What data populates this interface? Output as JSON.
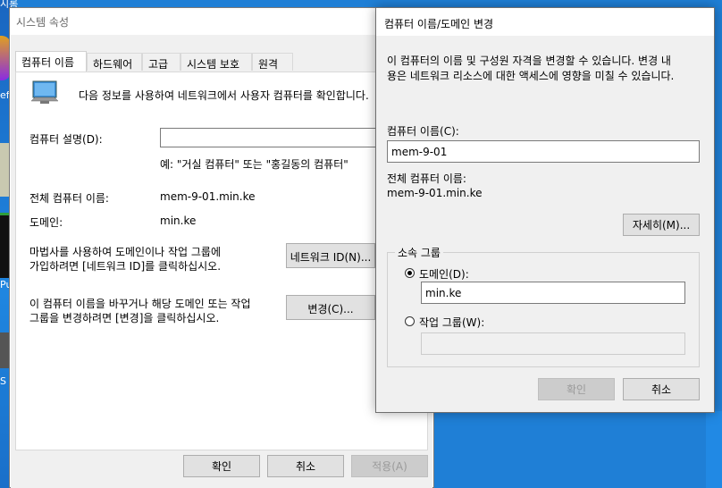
{
  "desktop": {
    "top_label": "시롬",
    "side_labels": [
      "ef",
      "Pu",
      "S"
    ]
  },
  "system_properties": {
    "title": "시스템 속성",
    "tabs": [
      {
        "label": "컴퓨터 이름",
        "active": true
      },
      {
        "label": "하드웨어",
        "active": false
      },
      {
        "label": "고급",
        "active": false
      },
      {
        "label": "시스템 보호",
        "active": false
      },
      {
        "label": "원격",
        "active": false
      }
    ],
    "intro_text": "다음 정보를 사용하여 네트워크에서 사용자 컴퓨터를 확인합니다.",
    "description_label": "컴퓨터 설명(D):",
    "description_value": "",
    "description_example": "예: \"거실 컴퓨터\" 또는 \"홍길동의 컴퓨터\"",
    "full_name_label": "전체 컴퓨터 이름:",
    "full_name_value": "mem-9-01.min.ke",
    "domain_label": "도메인:",
    "domain_value": "min.ke",
    "network_id_text_line1": "마법사를 사용하여 도메인이나 작업 그룹에",
    "network_id_text_line2": "가입하려면 [네트워크 ID]를 클릭하십시오.",
    "network_id_button": "네트워크 ID(N)...",
    "change_text_line1": "이 컴퓨터 이름을 바꾸거나 해당 도메인 또는 작업",
    "change_text_line2": "그룹을 변경하려면 [변경]을 클릭하십시오.",
    "change_button": "변경(C)...",
    "ok_button": "확인",
    "cancel_button": "취소",
    "apply_button": "적용(A)"
  },
  "rename_dialog": {
    "title": "컴퓨터 이름/도메인 변경",
    "intro_line1": "이 컴퓨터의 이름 및 구성원 자격을 변경할 수 있습니다. 변경 내",
    "intro_line2": "용은 네트워크 리소스에 대한 액세스에 영향을 미칠 수 있습니다.",
    "computer_name_label": "컴퓨터 이름(C):",
    "computer_name_value": "mem-9-01",
    "full_name_label": "전체 컴퓨터 이름:",
    "full_name_value": "mem-9-01.min.ke",
    "more_button": "자세히(M)...",
    "member_of_legend": "소속 그룹",
    "domain_radio_label": "도메인(D):",
    "domain_value": "min.ke",
    "workgroup_radio_label": "작업 그룹(W):",
    "workgroup_value": "",
    "selected_membership": "domain",
    "ok_button": "확인",
    "cancel_button": "취소"
  },
  "colors": {
    "accent": "#0078d7",
    "desktop": "#1f7fd6"
  }
}
